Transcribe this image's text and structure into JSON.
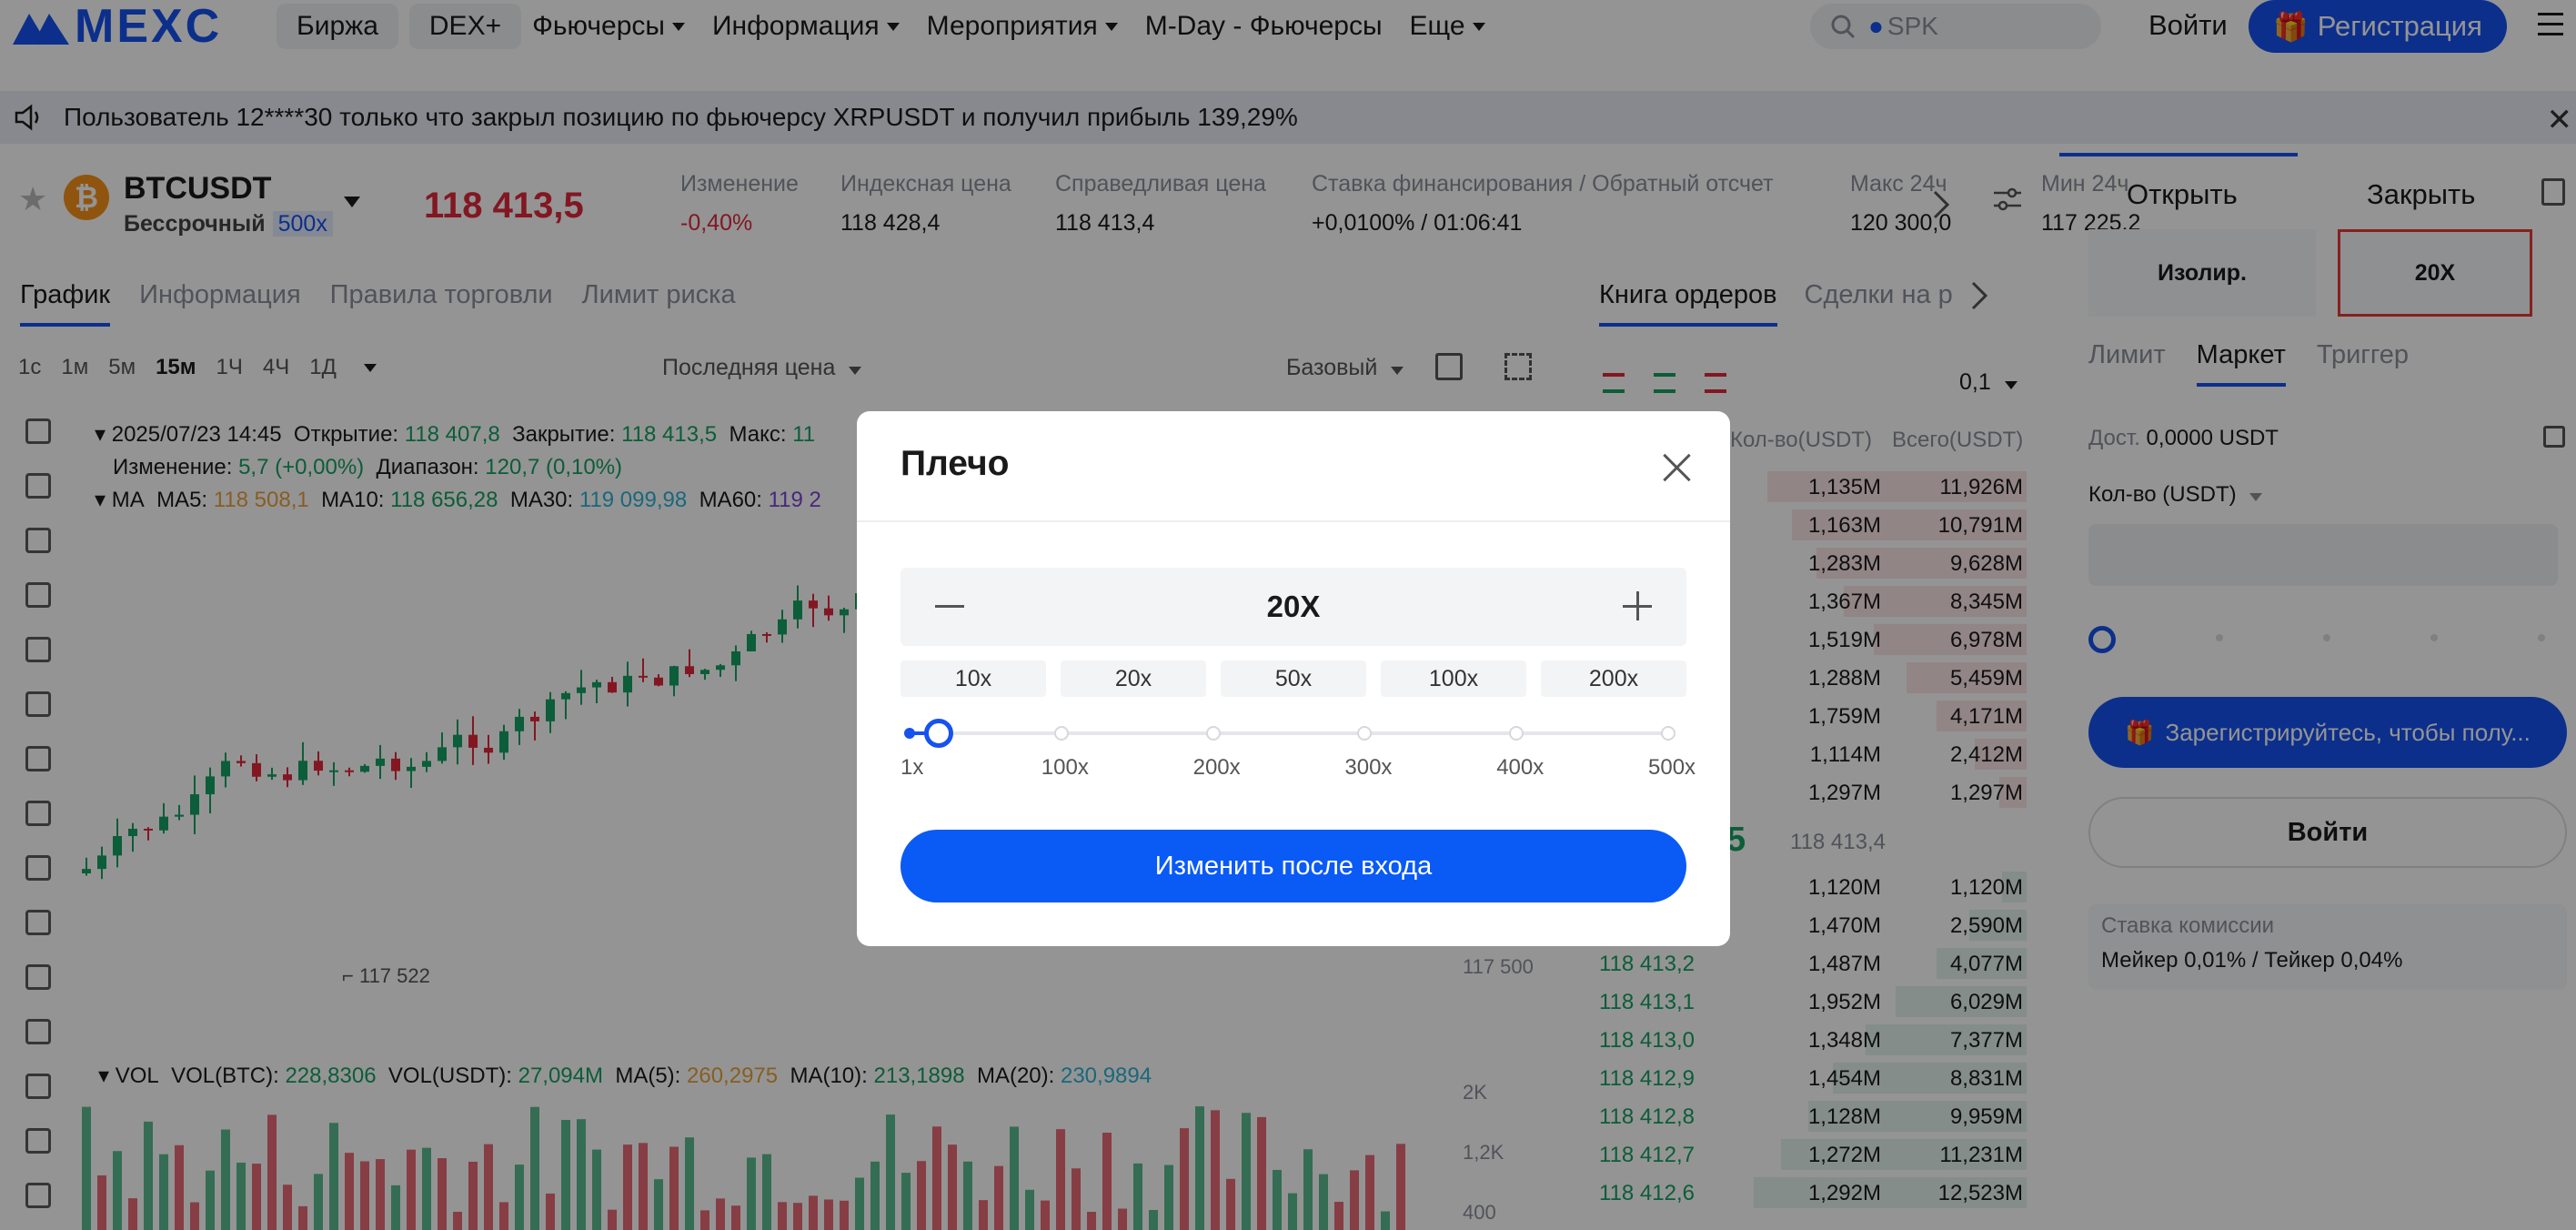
{
  "header": {
    "logo": "MEXC",
    "nav": [
      {
        "label": "Биржа",
        "pill": true,
        "caret": false
      },
      {
        "label": "DEX+",
        "pill": true,
        "caret": false
      },
      {
        "label": "Фьючерсы",
        "pill": false,
        "caret": true
      },
      {
        "label": "Информация",
        "pill": false,
        "caret": true
      },
      {
        "label": "Мероприятия",
        "pill": false,
        "caret": true
      },
      {
        "label": "M-Day - Фьючерсы",
        "pill": false,
        "caret": false
      },
      {
        "label": "Еще",
        "pill": false,
        "caret": true
      }
    ],
    "search_placeholder": "SPK",
    "login": "Войти",
    "register": "Регистрация"
  },
  "notice": {
    "text": "Пользователь 12****30 только что закрыл позицию по фьючерсу XRPUSDT и получил прибыль 139,29%"
  },
  "symbol": {
    "name": "BTCUSDT",
    "type": "Бессрочный",
    "leverage": "500x",
    "price": "118 413,5",
    "stats": [
      {
        "label": "Изменение",
        "value": "-0,40%",
        "color": "red"
      },
      {
        "label": "Индексная цена",
        "value": "118 428,4",
        "color": ""
      },
      {
        "label": "Справедливая цена",
        "value": "118 413,4",
        "color": ""
      },
      {
        "label": "Ставка финансирования / Обратный отсчет",
        "value": "+0,0100% / 01:06:41",
        "color": ""
      },
      {
        "label": "Макс 24ч",
        "value": "120 300,0",
        "color": ""
      },
      {
        "label": "Мин 24ч",
        "value": "117 225,2",
        "color": ""
      }
    ]
  },
  "chart": {
    "tabs": [
      "График",
      "Информация",
      "Правила торговли",
      "Лимит риска"
    ],
    "intervals": [
      "1с",
      "1м",
      "5м",
      "15м",
      "1Ч",
      "4Ч",
      "1Д"
    ],
    "active_interval": "15м",
    "price_type": "Последняя цена",
    "view": "Базовый",
    "info_line1_date": "2025/07/23 14:45",
    "open_label": "Открытие:",
    "open": "118 407,8",
    "close_label": "Закрытие:",
    "close": "118 413,5",
    "high_label": "Макс:",
    "high": "11",
    "change_label": "Изменение:",
    "change": "5,7 (+0,00%)",
    "range_label": "Диапазон:",
    "range": "120,7 (0,10%)",
    "ma_label": "MA",
    "ma5_label": "MA5:",
    "ma5": "118 508,1",
    "ma10_label": "MA10:",
    "ma10": "118 656,28",
    "ma30_label": "MA30:",
    "ma30": "119 099,98",
    "ma60_label": "MA60:",
    "ma60": "119 2",
    "low_marker": "117 522",
    "right_price": "117 500",
    "vol_label": "VOL",
    "vol_btc_label": "VOL(BTC):",
    "vol_btc": "228,8306",
    "vol_usdt_label": "VOL(USDT):",
    "vol_usdt": "27,094M",
    "vol_ma5_label": "MA(5):",
    "vol_ma5": "260,2975",
    "vol_ma10_label": "MA(10):",
    "vol_ma10": "213,1898",
    "vol_ma20_label": "MA(20):",
    "vol_ma20": "230,9894",
    "vol_axis": [
      "2K",
      "1,2K",
      "400"
    ]
  },
  "orderbook": {
    "tabs": [
      "Книга ордеров",
      "Сделки на р"
    ],
    "precision": "0,1",
    "headers": [
      "Кол-во(USDT)",
      "Всего(USDT)"
    ],
    "asks": [
      {
        "price": "",
        "qty": "1,135M",
        "total": "11,926M",
        "depth": 0.95
      },
      {
        "price": "",
        "qty": "1,163M",
        "total": "10,791M",
        "depth": 0.86
      },
      {
        "price": "",
        "qty": "1,283M",
        "total": "9,628M",
        "depth": 0.77
      },
      {
        "price": "",
        "qty": "1,367M",
        "total": "8,345M",
        "depth": 0.67
      },
      {
        "price": "",
        "qty": "1,519M",
        "total": "6,978M",
        "depth": 0.56
      },
      {
        "price": "",
        "qty": "1,288M",
        "total": "5,459M",
        "depth": 0.44
      },
      {
        "price": "",
        "qty": "1,759M",
        "total": "4,171M",
        "depth": 0.33
      },
      {
        "price": "",
        "qty": "1,114M",
        "total": "2,412M",
        "depth": 0.19
      },
      {
        "price": "",
        "qty": "1,297M",
        "total": "1,297M",
        "depth": 0.1
      }
    ],
    "mid_price": "5",
    "mid_index": "118 413,4",
    "bids": [
      {
        "price": "",
        "qty": "1,120M",
        "total": "1,120M",
        "depth": 0.09
      },
      {
        "price": "",
        "qty": "1,470M",
        "total": "2,590M",
        "depth": 0.21
      },
      {
        "price": "118 413,2",
        "qty": "1,487M",
        "total": "4,077M",
        "depth": 0.33
      },
      {
        "price": "118 413,1",
        "qty": "1,952M",
        "total": "6,029M",
        "depth": 0.48
      },
      {
        "price": "118 413,0",
        "qty": "1,348M",
        "total": "7,377M",
        "depth": 0.59
      },
      {
        "price": "118 412,9",
        "qty": "1,454M",
        "total": "8,831M",
        "depth": 0.71
      },
      {
        "price": "118 412,8",
        "qty": "1,128M",
        "total": "9,959M",
        "depth": 0.8
      },
      {
        "price": "118 412,7",
        "qty": "1,272M",
        "total": "11,231M",
        "depth": 0.9
      },
      {
        "price": "118 412,6",
        "qty": "1,292M",
        "total": "12,523M",
        "depth": 1.0
      }
    ]
  },
  "trade": {
    "tabs": [
      "Открыть",
      "Закрыть"
    ],
    "margin_mode": "Изолир.",
    "leverage": "20X",
    "order_types": [
      "Лимит",
      "Маркет",
      "Триггер"
    ],
    "active_order_type": "Маркет",
    "available_label": "Дост.",
    "available": "0,0000 USDT",
    "qty_label": "Кол-во (USDT)",
    "register_cta": "Зарегистрируйтесь, чтобы полу...",
    "login": "Войти",
    "fee_label": "Ставка комиссии",
    "fee_value": "Мейкер 0,01% / Тейкер 0,04%"
  },
  "modal": {
    "title": "Плечо",
    "value": "20X",
    "presets": [
      "10x",
      "20x",
      "50x",
      "100x",
      "200x"
    ],
    "slider_labels": [
      "1x",
      "100x",
      "200x",
      "300x",
      "400x",
      "500x"
    ],
    "slider_min": 1,
    "slider_max": 500,
    "slider_value": 20,
    "primary_button": "Изменить после входа"
  }
}
